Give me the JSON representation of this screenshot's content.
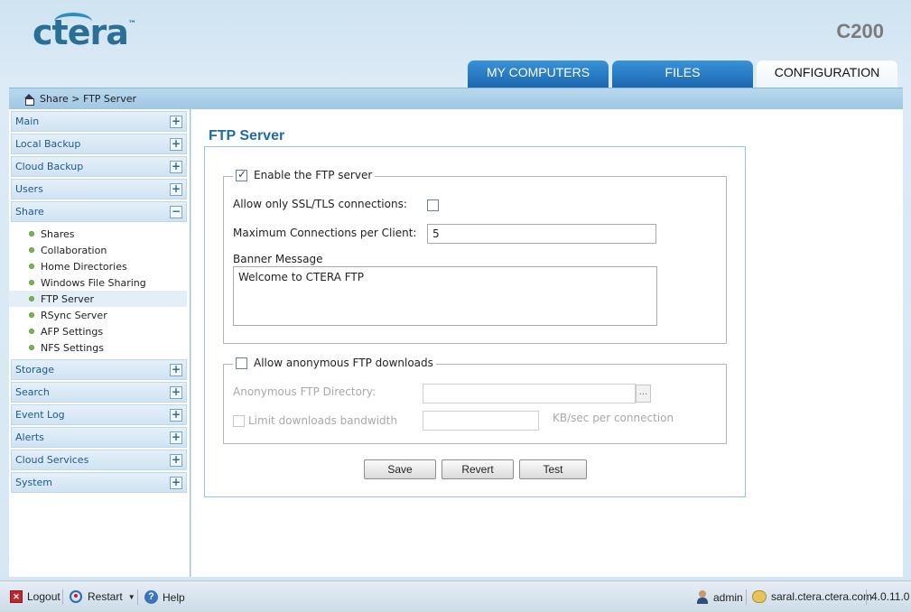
{
  "header": {
    "logo_text": "ctera",
    "logo_tm": "™",
    "model": "C200",
    "tabs": [
      {
        "label": "MY COMPUTERS"
      },
      {
        "label": "FILES"
      },
      {
        "label": "CONFIGURATION"
      }
    ]
  },
  "breadcrumb": "Share > FTP Server",
  "sidebar": {
    "sections": [
      {
        "label": "Main",
        "toggle": "+"
      },
      {
        "label": "Local Backup",
        "toggle": "+"
      },
      {
        "label": "Cloud Backup",
        "toggle": "+"
      },
      {
        "label": "Users",
        "toggle": "+"
      },
      {
        "label": "Share",
        "toggle": "−"
      },
      {
        "label": "Storage",
        "toggle": "+"
      },
      {
        "label": "Search",
        "toggle": "+"
      },
      {
        "label": "Event Log",
        "toggle": "+"
      },
      {
        "label": "Alerts",
        "toggle": "+"
      },
      {
        "label": "Cloud Services",
        "toggle": "+"
      },
      {
        "label": "System",
        "toggle": "+"
      }
    ],
    "share_items": [
      {
        "label": "Shares"
      },
      {
        "label": "Collaboration"
      },
      {
        "label": "Home Directories"
      },
      {
        "label": "Windows File Sharing"
      },
      {
        "label": "FTP Server"
      },
      {
        "label": "RSync Server"
      },
      {
        "label": "AFP Settings"
      },
      {
        "label": "NFS Settings"
      }
    ]
  },
  "main": {
    "title": "FTP Server",
    "enable_label": "Enable the FTP server",
    "enable_checked": true,
    "ssl_label": "Allow only SSL/TLS connections:",
    "ssl_checked": false,
    "maxconn_label": "Maximum Connections per Client:",
    "maxconn_value": "5",
    "banner_label": "Banner Message",
    "banner_value": "Welcome to CTERA FTP",
    "anon_label": "Allow anonymous FTP downloads",
    "anon_checked": false,
    "anon_dir_label": "Anonymous FTP Directory:",
    "anon_dir_value": "",
    "browse_label": "...",
    "limit_label": "Limit downloads bandwidth",
    "limit_value": "",
    "limit_unit": "KB/sec per connection",
    "buttons": {
      "save": "Save",
      "revert": "Revert",
      "test": "Test"
    }
  },
  "footer": {
    "logout": "Logout",
    "restart": "Restart",
    "help": "Help",
    "user": "admin",
    "server": "saral.ctera.ctera.com",
    "version": "4.0.11.0"
  },
  "colors": {
    "accent": "#1f6aa8",
    "tab_blue": "#1b67b2",
    "status_dot": "#78b84a"
  }
}
